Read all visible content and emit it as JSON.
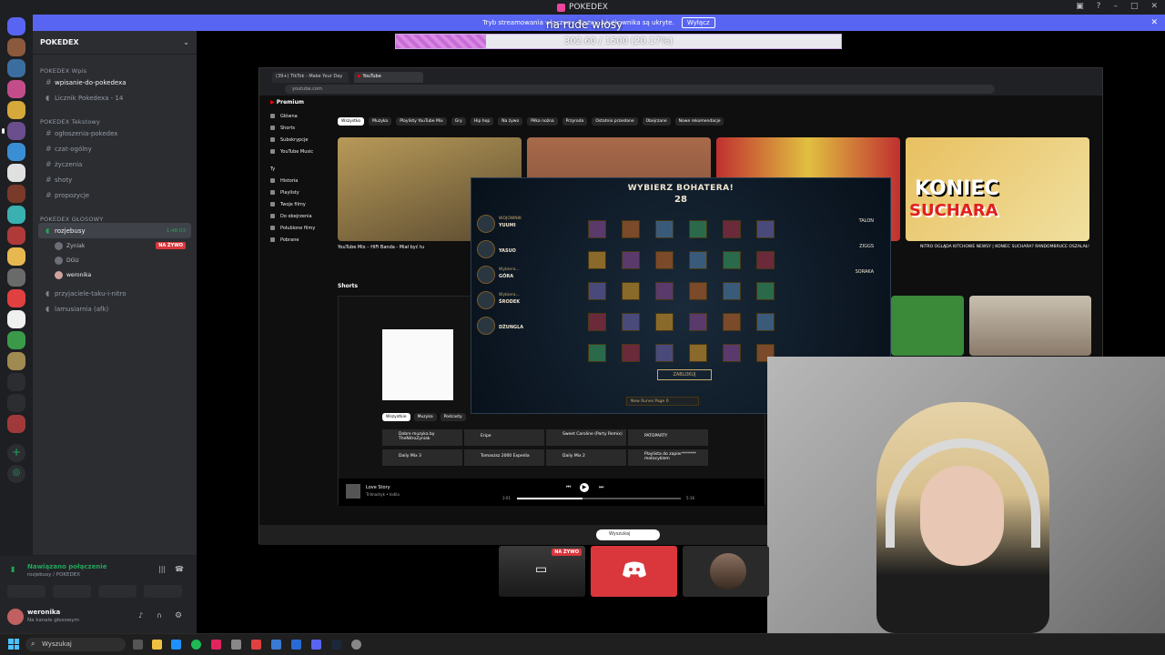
{
  "window": {
    "title": "POKEDEX"
  },
  "banner": {
    "text": "Tryb streamowania włączony. Nazwy użytkownika są ukryte. ",
    "button": "Wyłącz"
  },
  "overlay": {
    "title": "na rude włosy",
    "progress_text": "302.60 / 1500 (20.17%)",
    "progress_fraction": 0.2017
  },
  "sidebar": {
    "server_name": "POKEDEX",
    "categories": [
      {
        "name": "POKEDEX Wpis",
        "channels": [
          "wpisanie-do-pokedexa",
          "Licznik Pokedexa - 14"
        ]
      },
      {
        "name": "POKEDEX Tekstowy",
        "channels": [
          "ogłoszenia-pokedex",
          "czat-ogólny",
          "życzenia",
          "shoty",
          "propozycje"
        ]
      },
      {
        "name": "POKEDEX GŁOSOWY",
        "channels": []
      }
    ],
    "voice_channel": {
      "name": "rozjebusy",
      "time": "1:48:03",
      "users": [
        {
          "name": "Zyniak",
          "badge": "NA ŻYWO"
        },
        {
          "name": "DGU",
          "badge": ""
        },
        {
          "name": "weronika",
          "badge": ""
        }
      ]
    },
    "more_channels": [
      "przyjaciele-taku-i-nitro",
      "lamusiarnia (afk)"
    ]
  },
  "voice_panel": {
    "status": "Nawiązano połączenie",
    "location": "rozjebusy / POKEDEX"
  },
  "user_panel": {
    "name": "weronika",
    "status": "Na kanale głosowym"
  },
  "stream": {
    "browser": {
      "tab1": "(39+) TikTok - Make Your Day",
      "tab2": "YouTube",
      "url": "youtube.com"
    },
    "youtube": {
      "sidebar": [
        "Główna",
        "Shorts",
        "Subskrypcje",
        "YouTube Music",
        "Ty",
        "Historia",
        "Playlisty",
        "Twoje filmy",
        "Do obejrzenia",
        "Polubione filmy",
        "Pobrane"
      ],
      "chips": [
        "Wszystko",
        "Muzyka",
        "Playlisty YouTube Mix",
        "Gry",
        "Hip hop",
        "Na żywo",
        "Piłka nożna",
        "Przyroda",
        "Ostatnio przesłane",
        "Obejrzane",
        "Nowe rekomendacje"
      ],
      "video_title": "YouTube Mix – HiFi Banda - Miał być tu",
      "shorts_label": "Shorts",
      "thumb_text_1": "KONIEC",
      "thumb_text_2": "SUCHARA",
      "right_video_title": "NITRO OGLĄDA KITCHOWE NEWSY | KONIEC SUCHARA? RANDOMBRUCE OSZALAŁ!"
    },
    "league": {
      "title": "WYBIERZ BOHATERA!",
      "timer": "28",
      "picks": [
        {
          "role": "WOJOWNIK",
          "name": "YUUMI"
        },
        {
          "role": "",
          "name": "YASUO"
        },
        {
          "role": "Wybiera...",
          "name": "GÓRA"
        },
        {
          "role": "Wybiera...",
          "name": "ŚRODEK"
        },
        {
          "role": "",
          "name": "DŻUNGLA"
        }
      ],
      "enemies": [
        "TALON",
        "ZIGGS",
        "SORAKA"
      ],
      "lock_button": "ZABLOKUJ",
      "rune_page": "New Runes Page 0"
    },
    "spotify": {
      "filter_chips": [
        "Wszystkie",
        "Muzyka",
        "Podcasty"
      ],
      "tiles": [
        "Dobre muzyka by TheNitroZyniak",
        "Eripe",
        "Sweet Caroline (Party Remix)",
        "PATOPARTY",
        "Daily Mix 3",
        "Tomaszsz 2000 Expedia",
        "Daily Mix 2",
        "Playlista do zapier******* motocyklem"
      ],
      "now_playing": "Love Story",
      "artist": "Trilmadryk • Indila",
      "time_elapsed": "3:01",
      "time_total": "5:16"
    },
    "taskbar_search": "Wyszukaj"
  },
  "call_tiles": {
    "live_badge": "NA ŻYWO"
  },
  "taskbar": {
    "search": "Wyszukaj"
  },
  "colors": {
    "discord_blurple": "#5865f2",
    "live_red": "#da373c",
    "online_green": "#23a55a",
    "progress_fill": "#c86bd6"
  }
}
